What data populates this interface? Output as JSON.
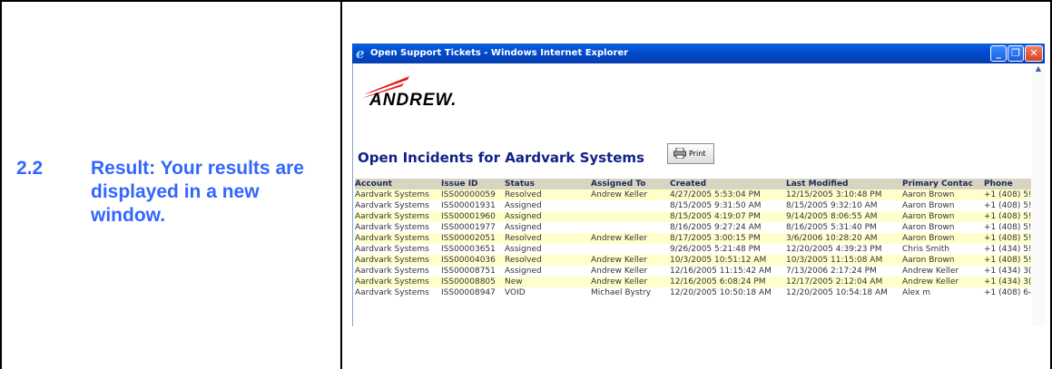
{
  "document": {
    "step_number": "2.2",
    "step_text": "Result:  Your results are displayed in a new window."
  },
  "browser": {
    "title": "Open Support Tickets - Windows Internet Explorer",
    "minimize_glyph": "_",
    "maximize_glyph": "❐",
    "close_glyph": "✕",
    "scroll_up_glyph": "▲"
  },
  "page": {
    "brand": "ANDREW.",
    "heading": "Open Incidents for Aardvark Systems",
    "print_label": "Print"
  },
  "colors": {
    "instruction_text": "#3366ff",
    "heading": "#12218a",
    "row_highlight": "#ffffcc",
    "header_background": "#d8d4c2",
    "brand_red": "#e01d1d"
  },
  "table": {
    "columns": [
      "Account",
      "Issue ID",
      "Status",
      "Assigned To",
      "Created",
      "Last Modified",
      "Primary Contac",
      "Phone"
    ],
    "rows": [
      {
        "cells": [
          "Aardvark Systems",
          "ISS00000059",
          "Resolved",
          "Andrew Keller",
          "4/27/2005 5:53:04 PM",
          "12/15/2005 3:10:48 PM",
          "Aaron Brown",
          "+1 (408) 5!"
        ],
        "highlight": true
      },
      {
        "cells": [
          "Aardvark Systems",
          "ISS00001931",
          "Assigned",
          "",
          "8/15/2005 9:31:50 AM",
          "8/15/2005 9:32:10 AM",
          "Aaron Brown",
          "+1 (408) 5!"
        ],
        "highlight": false
      },
      {
        "cells": [
          "Aardvark Systems",
          "ISS00001960",
          "Assigned",
          "",
          "8/15/2005 4:19:07 PM",
          "9/14/2005 8:06:55 AM",
          "Aaron Brown",
          "+1 (408) 5!"
        ],
        "highlight": true
      },
      {
        "cells": [
          "Aardvark Systems",
          "ISS00001977",
          "Assigned",
          "",
          "8/16/2005 9:27:24 AM",
          "8/16/2005 5:31:40 PM",
          "Aaron Brown",
          "+1 (408) 5!"
        ],
        "highlight": false
      },
      {
        "cells": [
          "Aardvark Systems",
          "ISS00002051",
          "Resolved",
          "Andrew Keller",
          "8/17/2005 3:00:15 PM",
          "3/6/2006 10:28:20 AM",
          "Aaron Brown",
          "+1 (408) 5!"
        ],
        "highlight": true
      },
      {
        "cells": [
          "Aardvark Systems",
          "ISS00003651",
          "Assigned",
          "",
          "9/26/2005 5:21:48 PM",
          "12/20/2005 4:39:23 PM",
          "Chris Smith",
          "+1 (434) 5!"
        ],
        "highlight": false
      },
      {
        "cells": [
          "Aardvark Systems",
          "ISS00004036",
          "Resolved",
          "Andrew Keller",
          "10/3/2005 10:51:12 AM",
          "10/3/2005 11:15:08 AM",
          "Aaron Brown",
          "+1 (408) 5!"
        ],
        "highlight": true
      },
      {
        "cells": [
          "Aardvark Systems",
          "ISS00008751",
          "Assigned",
          "Andrew Keller",
          "12/16/2005 11:15:42 AM",
          "7/13/2006 2:17:24 PM",
          "Andrew Keller",
          "+1 (434) 3("
        ],
        "highlight": false
      },
      {
        "cells": [
          "Aardvark Systems",
          "ISS00008805",
          "New",
          "Andrew Keller",
          "12/16/2005 6:08:24 PM",
          "12/17/2005 2:12:04 AM",
          "Andrew Keller",
          "+1 (434) 3("
        ],
        "highlight": true
      },
      {
        "cells": [
          "Aardvark Systems",
          "ISS00008947",
          "VOID",
          "Michael Bystry",
          "12/20/2005 10:50:18 AM",
          "12/20/2005 10:54:18 AM",
          "Alex m",
          "+1 (408) 6-"
        ],
        "highlight": false
      }
    ]
  }
}
